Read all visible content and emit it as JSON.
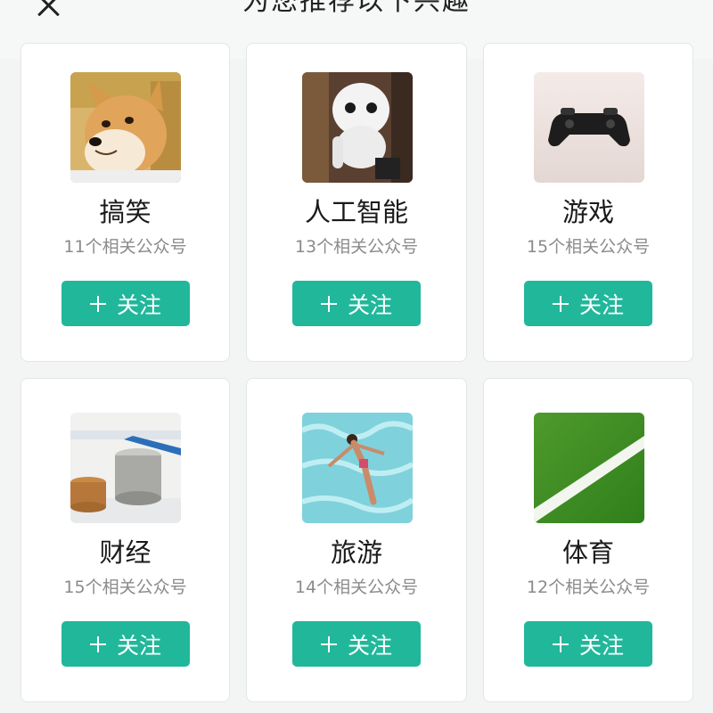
{
  "header": {
    "title": "为您推荐以下兴趣"
  },
  "cards": [
    {
      "title": "搞笑",
      "count": "11个相关公众号",
      "button": "关注",
      "image": "shiba-dog"
    },
    {
      "title": "人工智能",
      "count": "13个相关公众号",
      "button": "关注",
      "image": "robot"
    },
    {
      "title": "游戏",
      "count": "15个相关公众号",
      "button": "关注",
      "image": "game-controller"
    },
    {
      "title": "财经",
      "count": "15个相关公众号",
      "button": "关注",
      "image": "coin-stacks"
    },
    {
      "title": "旅游",
      "count": "14个相关公众号",
      "button": "关注",
      "image": "swimmer-pool"
    },
    {
      "title": "体育",
      "count": "12个相关公众号",
      "button": "关注",
      "image": "soccer-field"
    }
  ],
  "colors": {
    "accent": "#21b79a",
    "background": "#f3f5f4"
  }
}
